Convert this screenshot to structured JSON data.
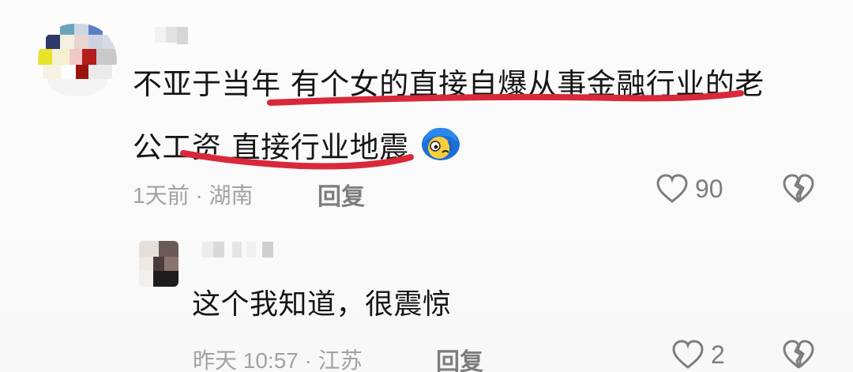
{
  "comment": {
    "text_line_1": "不亚于当年 有个女的直接自爆从事金融行业的老",
    "text_line_2": "公工资  直接行业地震",
    "emoji": "shocked-face-emoji",
    "meta": "1天前 · 湖南",
    "reply_label": "回复",
    "like_count": "90"
  },
  "reply": {
    "text": "这个我知道，很震惊",
    "meta": "昨天 10:57 · 江苏",
    "reply_label": "回复",
    "like_count": "2"
  },
  "icons": {
    "like": "heart-outline-icon",
    "dislike": "broken-heart-icon"
  },
  "colors": {
    "annotation_underline": "#d8283a",
    "meta_text": "#a2a2a2",
    "action_text": "#7d7d7d"
  }
}
